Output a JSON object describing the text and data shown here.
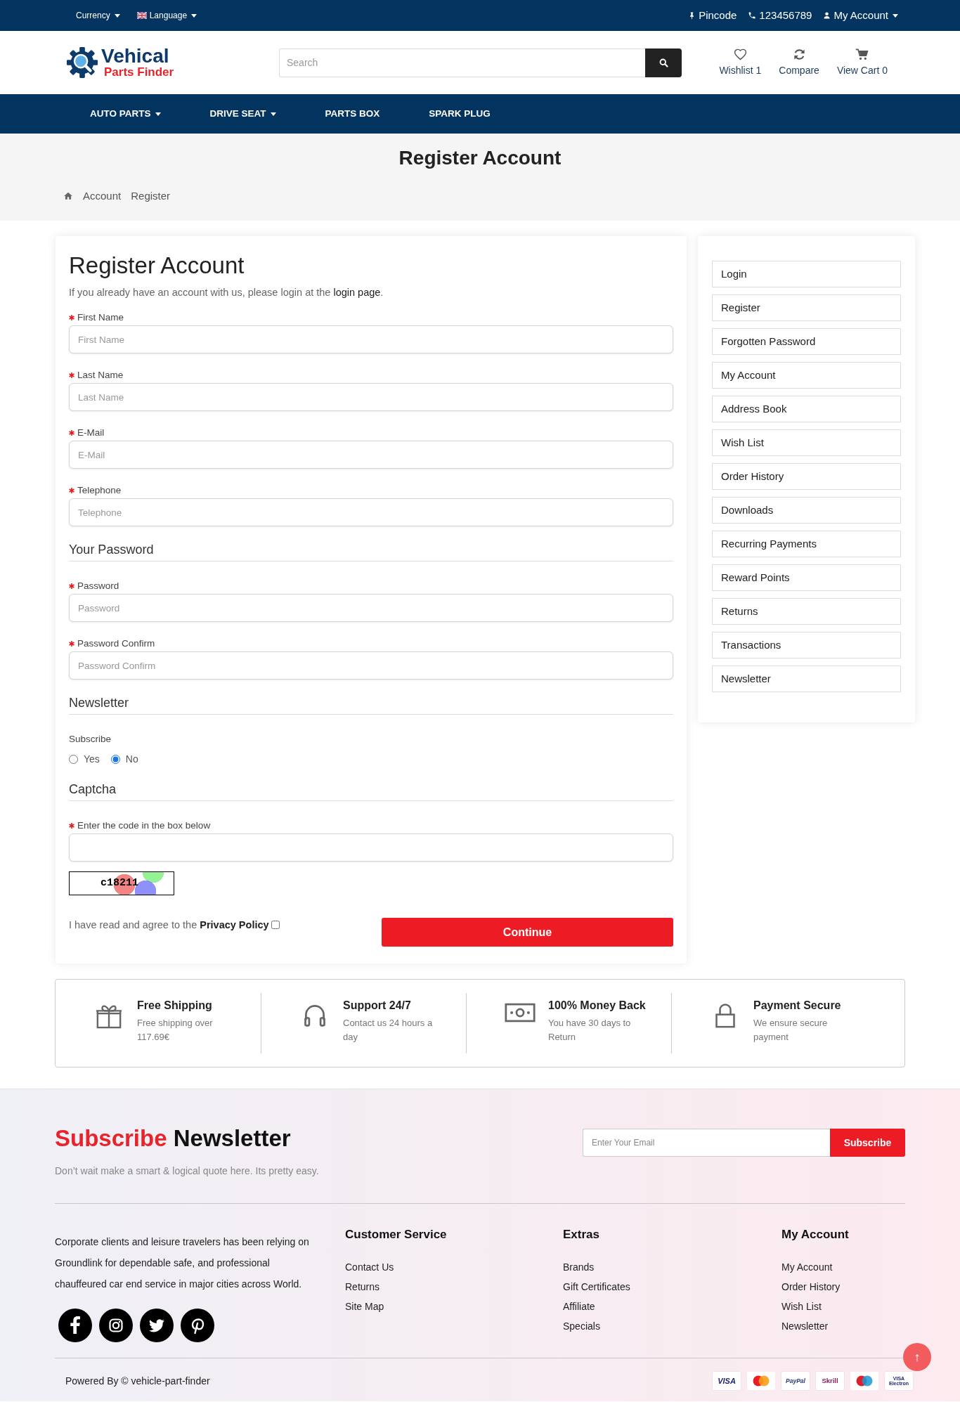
{
  "top_bar": {
    "currency": "Currency",
    "language": "Language",
    "pincode": "Pincode",
    "phone": "123456789",
    "account": "My Account"
  },
  "header": {
    "logo": {
      "line_1": "Vehical",
      "line_2": "Parts Finder"
    },
    "search": {
      "placeholder": "Search"
    },
    "actions": [
      {
        "kind": "wishlist",
        "label": "Wishlist 1"
      },
      {
        "kind": "compare",
        "label": "Compare"
      },
      {
        "kind": "cart",
        "label": "View Cart 0"
      }
    ]
  },
  "nav": [
    {
      "label": "AUTO PARTS",
      "dropdown": true
    },
    {
      "label": "DRIVE SEAT",
      "dropdown": true
    },
    {
      "label": "PARTS BOX",
      "dropdown": false
    },
    {
      "label": "SPARK PLUG",
      "dropdown": false
    }
  ],
  "page_title": "Register Account",
  "breadcrumb": [
    "Account",
    "Register"
  ],
  "form": {
    "title": "Register Account",
    "intro": {
      "before": "If you already have an account with us, please login at the ",
      "link": "login page",
      "after": "."
    },
    "groups": [
      {
        "fields": [
          {
            "kind": "text",
            "label": "First Name",
            "required": true,
            "placeholder": "First Name"
          },
          {
            "kind": "text",
            "label": "Last Name",
            "required": true,
            "placeholder": "Last Name"
          },
          {
            "kind": "text",
            "label": "E-Mail",
            "required": true,
            "placeholder": "E-Mail"
          },
          {
            "kind": "text",
            "label": "Telephone",
            "required": true,
            "placeholder": "Telephone"
          }
        ]
      },
      {
        "legend": "Your Password",
        "fields": [
          {
            "kind": "text",
            "label": "Password",
            "required": true,
            "placeholder": "Password"
          },
          {
            "kind": "text",
            "label": "Password Confirm",
            "required": true,
            "placeholder": "Password Confirm"
          }
        ]
      },
      {
        "legend": "Newsletter",
        "fields": [
          {
            "kind": "radio",
            "label": "Subscribe",
            "required": false,
            "options": [
              {
                "label": "Yes",
                "selected": false
              },
              {
                "label": "No",
                "selected": true
              }
            ]
          }
        ]
      },
      {
        "legend": "Captcha",
        "fields": [
          {
            "kind": "captcha",
            "label": "Enter the code in the box below",
            "required": true,
            "code": "c18211"
          }
        ]
      }
    ],
    "agree": {
      "text": "I have read and agree to the **Privacy Policy**",
      "checked": false
    },
    "submit": "Continue"
  },
  "sidebar": {
    "items": [
      "Login",
      "Register",
      "Forgotten Password",
      "My Account",
      "Address Book",
      "Wish List",
      "Order History",
      "Downloads",
      "Recurring Payments",
      "Reward Points",
      "Returns",
      "Transactions",
      "Newsletter"
    ]
  },
  "features": [
    {
      "kind": "gift",
      "title": "Free Shipping",
      "text": "Free shipping over 117.69€"
    },
    {
      "kind": "headphones",
      "title": "Support 24/7",
      "text": "Contact us 24 hours a day"
    },
    {
      "kind": "money",
      "title": "100% Money Back",
      "text": "You have 30 days to Return"
    },
    {
      "kind": "lock",
      "title": "Payment Secure",
      "text": "We ensure secure payment"
    }
  ],
  "footer": {
    "newsletter": {
      "title_highlight": "Subscribe",
      "title_rest": "Newsletter",
      "text": "Don’t wait make a smart & logical quote here. Its pretty easy.",
      "placeholder": "Enter Your Email",
      "button": "Subscribe"
    },
    "about": "Corporate clients and leisure travelers has been relying on Groundlink for dependable safe, and professional chauffeured car end service in major cities across World.",
    "social": [
      {
        "kind": "facebook"
      },
      {
        "kind": "instagram"
      },
      {
        "kind": "twitter"
      },
      {
        "kind": "pinterest"
      }
    ],
    "columns": [
      {
        "title": "Customer Service",
        "links": [
          "Contact Us",
          "Returns",
          "Site Map"
        ]
      },
      {
        "title": "Extras",
        "links": [
          "Brands",
          "Gift Certificates",
          "Affiliate",
          "Specials"
        ]
      },
      {
        "title": "My Account",
        "links": [
          "My Account",
          "Order History",
          "Wish List",
          "Newsletter"
        ]
      }
    ],
    "copyright": "Powered By © vehicle-part-finder",
    "payments": [
      {
        "kind": "visa",
        "label": "VISA"
      },
      {
        "kind": "mastercard"
      },
      {
        "kind": "paypal",
        "label": "PayPal"
      },
      {
        "kind": "skrill",
        "label": "Skrill"
      },
      {
        "kind": "maestro"
      },
      {
        "kind": "visa_electron",
        "label": "VISA Electron"
      }
    ],
    "back_to_top": "↑"
  }
}
